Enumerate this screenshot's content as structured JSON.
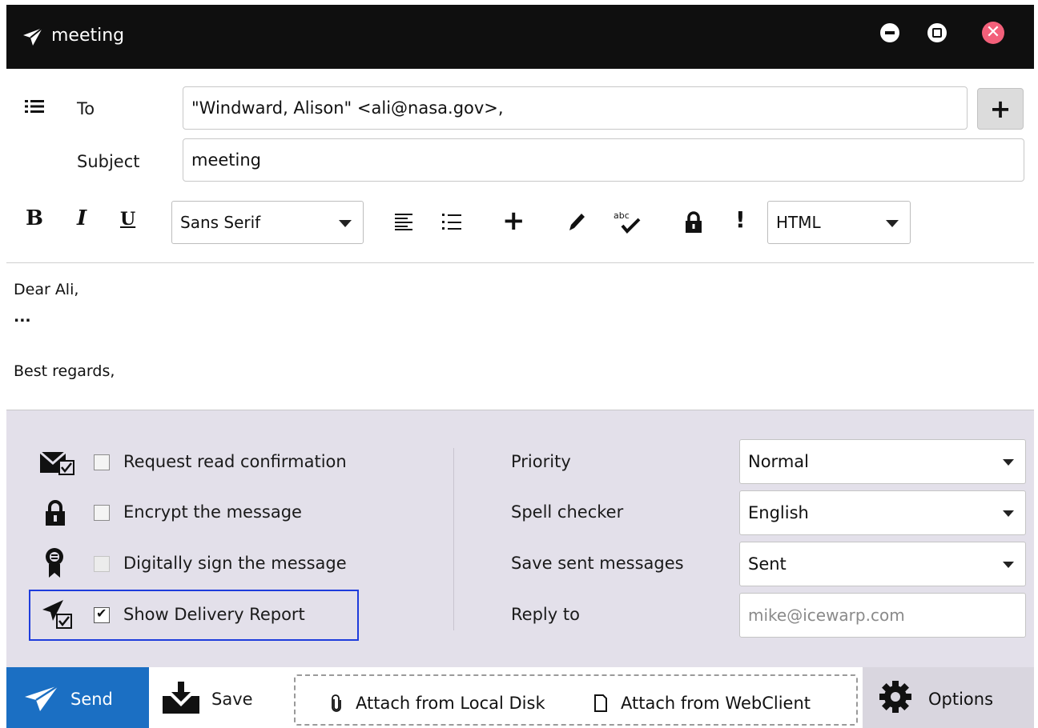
{
  "window": {
    "title": "meeting",
    "close_glyph": "✕"
  },
  "header": {
    "to_label": "To",
    "to_value": "\"Windward, Alison\" <ali@nasa.gov>,",
    "add_recipient_glyph": "+",
    "subject_label": "Subject",
    "subject_value": "meeting"
  },
  "toolbar": {
    "bold": "B",
    "italic": "I",
    "underline": "U",
    "font": "Sans Serif",
    "insert_glyph": "+",
    "priority_glyph": "!",
    "format": "HTML"
  },
  "body": {
    "lines": [
      "Dear Ali,",
      "...",
      "",
      "Best regards,"
    ]
  },
  "options": {
    "checks": [
      {
        "label": "Request read confirmation",
        "checked": false,
        "enabled": true,
        "icon": "mail-check-icon"
      },
      {
        "label": "Encrypt the message",
        "checked": false,
        "enabled": true,
        "icon": "lock-icon"
      },
      {
        "label": "Digitally sign the message",
        "checked": false,
        "enabled": false,
        "icon": "certificate-icon"
      },
      {
        "label": "Show Delivery Report",
        "checked": true,
        "enabled": true,
        "icon": "delivery-report-icon"
      }
    ],
    "priority_label": "Priority",
    "priority_value": "Normal",
    "spell_label": "Spell checker",
    "spell_value": "English",
    "save_sent_label": "Save sent messages",
    "save_sent_value": "Sent",
    "reply_to_label": "Reply to",
    "reply_to_placeholder": "mike@icewarp.com"
  },
  "bottom": {
    "send": "Send",
    "save": "Save",
    "attach_local": "Attach from Local Disk",
    "attach_web": "Attach from WebClient",
    "options": "Options"
  },
  "colors": {
    "titlebar": "#0f0f0f",
    "send_button": "#1b6fc3",
    "options_panel": "#e3e0ea",
    "highlight": "#1e3cdc",
    "close_button": "#f3607a"
  }
}
